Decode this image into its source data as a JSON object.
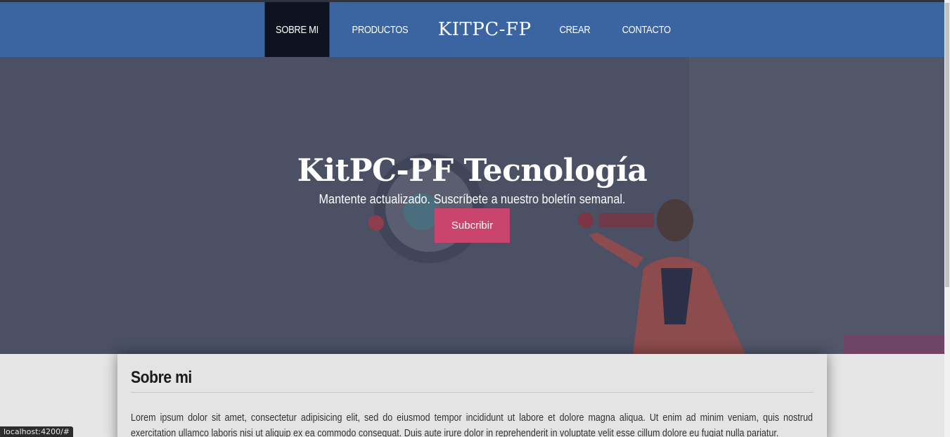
{
  "nav": {
    "items": [
      {
        "label": "SOBRE MI",
        "active": true
      },
      {
        "label": "PRODUCTOS",
        "active": false
      },
      {
        "label": "CREAR",
        "active": false
      },
      {
        "label": "CONTACTO",
        "active": false
      }
    ],
    "brand": "KITPC-FP"
  },
  "hero": {
    "title": "KitPC-PF Tecnología",
    "subtitle": "Mantente actualizado. Suscríbete a nuestro boletín semanal.",
    "button_label": "Subcribir"
  },
  "about": {
    "title": "Sobre mi",
    "text": "Lorem ipsum dolor sit amet, consectetur adipisicing elit, sed do eiusmod tempor incididunt ut labore et dolore magna aliqua. Ut enim ad minim veniam, quis nostrud exercitation ullamco laboris nisi ut aliquip ex ea commodo consequat. Duis aute irure dolor in reprehenderit in voluptate velit esse cillum dolore eu fugiat nulla pariatur."
  },
  "status_bar": {
    "url": "localhost:4200/#"
  },
  "colors": {
    "nav_bg": "#3a65a0",
    "nav_active": "#0d1320",
    "button": "#c9456f"
  }
}
